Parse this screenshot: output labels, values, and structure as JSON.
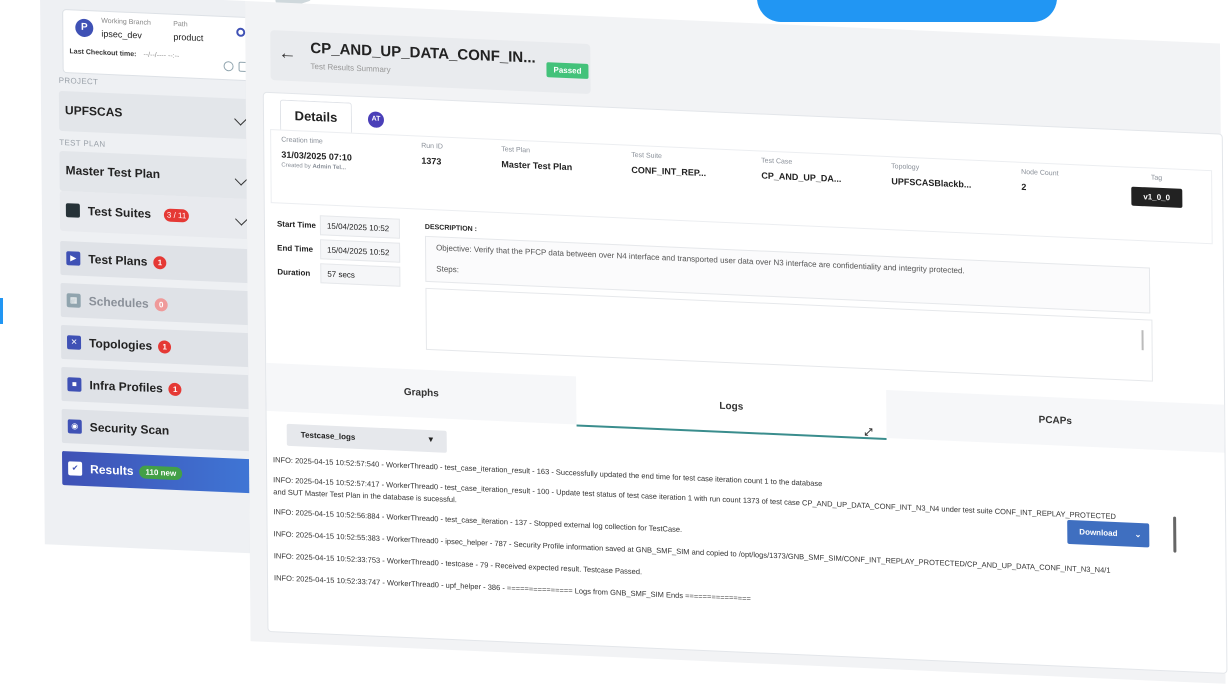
{
  "sidebar": {
    "branch_label": "Working Branch",
    "branch_value": "ipsec_dev",
    "path_label": "Path",
    "path_value": "product",
    "checkout_label": "Last Checkout time:",
    "checkout_value": "--/--/---- --:--",
    "project_label": "PROJECT",
    "project_value": "UPFSCAS",
    "testplan_label": "TEST PLAN",
    "testplan_value": "Master Test Plan",
    "suites": {
      "label": "Test Suites",
      "badge": "3 / 11"
    },
    "items": [
      {
        "label": "Test Plans",
        "badge": "1",
        "icon": "play-icon"
      },
      {
        "label": "Schedules",
        "badge": "0",
        "icon": "calendar-icon"
      },
      {
        "label": "Topologies",
        "badge": "1",
        "icon": "network-icon"
      },
      {
        "label": "Infra Profiles",
        "badge": "1",
        "icon": "server-icon"
      },
      {
        "label": "Security Scan",
        "badge": "",
        "icon": "scan-icon"
      },
      {
        "label": "Results",
        "badge": "110 new",
        "icon": "results-icon"
      }
    ]
  },
  "header": {
    "title": "CP_AND_UP_DATA_CONF_IN...",
    "subtitle": "Test Results Summary",
    "status": "Passed"
  },
  "details": {
    "tab_label": "Details",
    "avatar_initials": "AT",
    "creation_time_label": "Creation time",
    "creation_time": "31/03/2025 07:10",
    "created_by_label": "Created by",
    "created_by": "Admin Tel...",
    "run_id_label": "Run ID",
    "run_id": "1373",
    "test_plan_label": "Test Plan",
    "test_plan": "Master Test Plan",
    "test_suite_label": "Test Suite",
    "test_suite": "CONF_INT_REP...",
    "test_case_label": "Test Case",
    "test_case": "CP_AND_UP_DA...",
    "topology_label": "Topology",
    "topology": "UPFSCASBlackb...",
    "node_count_label": "Node Count",
    "node_count": "2",
    "tag_label": "Tag",
    "tag": "v1_0_0",
    "start_label": "Start Time",
    "start_value": "15/04/2025 10:52",
    "end_label": "End Time",
    "end_value": "15/04/2025 10:52",
    "duration_label": "Duration",
    "duration_value": "57 secs",
    "description_label": "DESCRIPTION :",
    "objective": "Objective: Verify that the PFCP data between over N4 interface and transported user data over N3 interface are confidentiality and integrity protected.",
    "steps": "Steps:"
  },
  "tabs": [
    "Graphs",
    "Logs",
    "PCAPs"
  ],
  "logs": {
    "select_value": "Testcase_logs",
    "download_label": "Download",
    "lines": [
      "INFO: 2025-04-15 10:52:57:540 - WorkerThread0 - test_case_iteration_result - 163 - Successfully updated the end time for test case iteration count 1 to the database",
      "INFO: 2025-04-15 10:52:57:417 - WorkerThread0 - test_case_iteration_result - 100 - Update test status of test case iteration 1 with run count 1373 of test case CP_AND_UP_DATA_CONF_INT_N3_N4 under test suite CONF_INT_REPLAY_PROTECTED",
      "and SUT Master Test Plan in the database is sucessful.",
      "INFO: 2025-04-15 10:52:56:884 - WorkerThread0 - test_case_iteration - 137 - Stopped external log collection for TestCase.",
      "INFO: 2025-04-15 10:52:55:383 - WorkerThread0 - ipsec_helper - 787 - Security Profile information saved at GNB_SMF_SIM and copied to /opt/logs/1373/GNB_SMF_SIM/CONF_INT_REPLAY_PROTECTED/CP_AND_UP_DATA_CONF_INT_N3_N4/1",
      "INFO: 2025-04-15 10:52:33:753 - WorkerThread0 - testcase - 79 - Received expected result. Testcase Passed.",
      "INFO: 2025-04-15 10:52:33:747 - WorkerThread0 - upf_helper - 386 - =============== Logs from GNB_SMF_SIM Ends ==============="
    ]
  }
}
